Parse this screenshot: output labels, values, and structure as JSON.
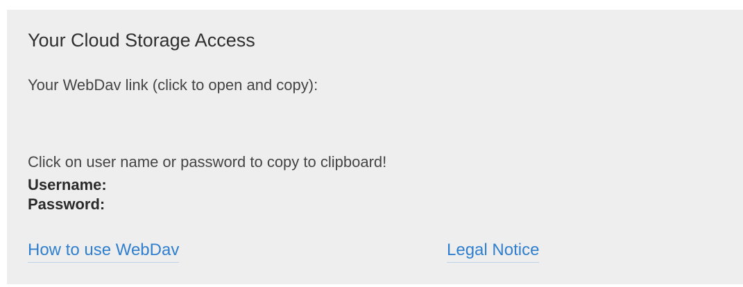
{
  "panel": {
    "title": "Your Cloud Storage Access",
    "webdav_text": "Your WebDav link (click to open and copy):",
    "webdav_link": "",
    "clipboard_hint": "Click on user name or password to copy to clipboard!",
    "username_label": "Username:",
    "username_value": "",
    "password_label": "Password:",
    "password_value": ""
  },
  "footer": {
    "howto_label": "How to use WebDav",
    "legal_label": "Legal Notice"
  },
  "colors": {
    "panel_background": "#eeeeee",
    "link": "#2f7fce",
    "text": "#333333"
  }
}
